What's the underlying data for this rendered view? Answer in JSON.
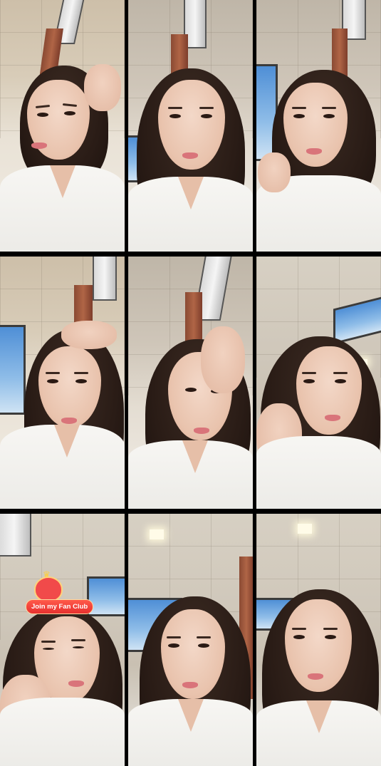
{
  "collage": {
    "panel_count": 9,
    "layout": "3x3 grid",
    "sticker": {
      "label": "Join my Fan Club",
      "icon": "heart-mascot-icon",
      "crown_icon": "crown-icon",
      "colors": {
        "label_bg": "#e7302f",
        "heart": "#f14a4a",
        "crown": "#ffcf3a"
      }
    },
    "colors": {
      "separator": "#000000",
      "robe": "#f5f4f1",
      "hair": "#2a1c16",
      "sky_window": "#4f8fd6"
    }
  }
}
